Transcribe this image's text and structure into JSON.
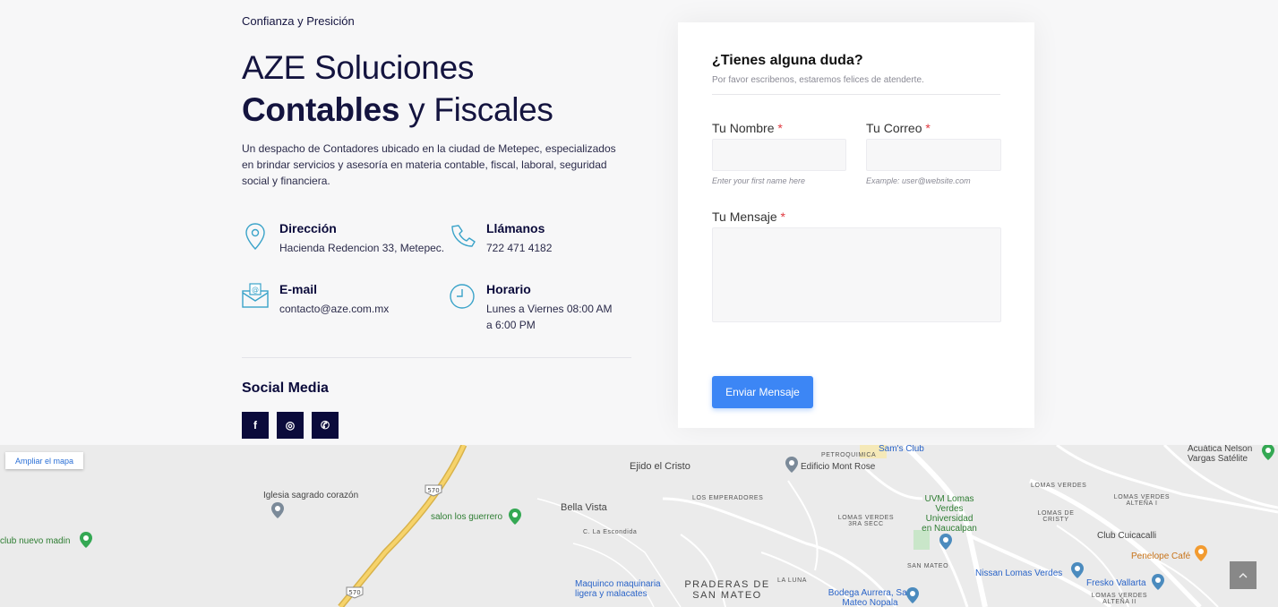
{
  "hero": {
    "kicker": "Confianza y Presición",
    "title_light": "AZE Soluciones ",
    "title_bold": "Contables",
    "title_end": " y Fiscales",
    "description": "Un despacho de Contadores ubicado en la ciudad de Metepec, especializados en brindar servicios y asesoría en materia contable, fiscal, laboral, seguridad social y financiera."
  },
  "contact": {
    "address_title": "Dirección",
    "address_value": "Hacienda Redencion 33, Metepec.",
    "phone_title": "Llámanos",
    "phone_value": "722 471 4182",
    "email_title": "E-mail",
    "email_value": "contacto@aze.com.mx",
    "hours_title": "Horario",
    "hours_value": "Lunes a Viernes 08:00 AM a 6:00 PM"
  },
  "social": {
    "title": "Social Media",
    "items": [
      "f",
      "◎",
      "✆"
    ]
  },
  "form": {
    "heading": "¿Tienes alguna duda?",
    "subheading": "Por favor escribenos, estaremos felices de atenderte.",
    "name_label": "Tu Nombre",
    "name_hint": "Enter your first name here",
    "email_label": "Tu Correo",
    "email_hint": "Example: user@website.com",
    "message_label": "Tu Mensaje",
    "required_mark": "*",
    "submit_label": "Enviar Mensaje"
  },
  "map": {
    "enlarge_label": "Ampliar el mapa",
    "places": [
      "Ejido el Cristo",
      "Edificio Mont Rose",
      "PETROQUIMICA",
      "Sam's Club",
      "Iglesia sagrado corazón",
      "salon los guerrero",
      "Bella Vista",
      "C. La Escondida",
      "club nuevo madin",
      "LOS EMPERADORES",
      "LOMAS VERDES 3RA SECC",
      "UVM Lomas Verdes Universidad en Naucalpan",
      "LOMAS VERDES",
      "LOMAS DE CRISTY",
      "LOMAS VERDES ALTEÑA I",
      "Acuática Nelson Vargas Satélite",
      "Club Cuicacalli",
      "Penelope Café",
      "SAN MATEO",
      "Nissan Lomas Verdes",
      "Fresko Vallarta",
      "Maquinco maquinaria ligera y malacates",
      "PRADERAS DE SAN MATEO",
      "LA LUNA",
      "Bodega Aurrera, San Mateo Nopala",
      "LOMAS VERDES ALTEÑA II"
    ],
    "road_shields": [
      "570",
      "570"
    ]
  },
  "scroll_top_icon": "chevron-up-icon",
  "colors": {
    "navy": "#0b0b3b",
    "accent_blue": "#3c86f5",
    "icon_teal": "#3aa3c9",
    "required_red": "#e0383e"
  }
}
